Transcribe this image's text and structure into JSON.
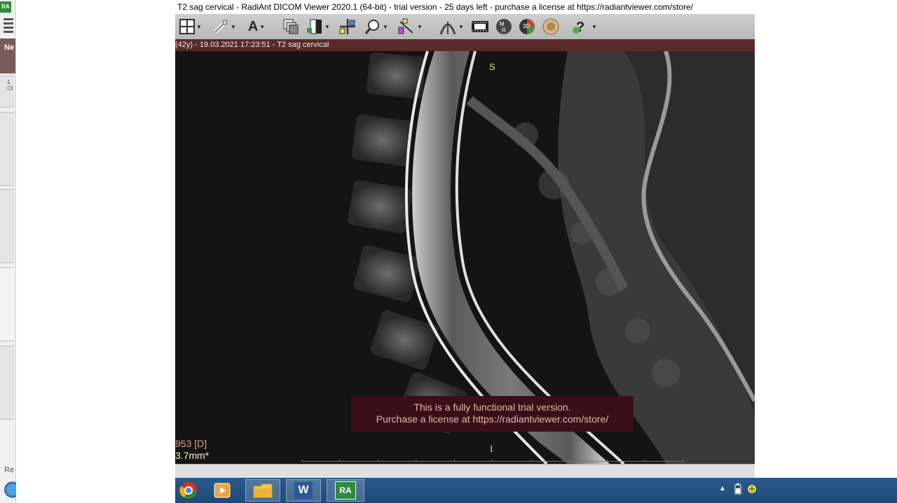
{
  "background_app": {
    "badge": "RA",
    "panel_label": "Ne",
    "thumb1_line1": "1",
    "thumb1_line2": "OI",
    "bottom_label": "Re"
  },
  "window": {
    "title": "T2 sag cervical - RadiAnt DICOM Viewer 2020.1 (64-bit) - trial version - 25 days left - purchase a license at https://radiantviewer.com/store/"
  },
  "toolbar": {
    "icons": [
      "layout-grid-icon",
      "adjust-wl-icon",
      "annotation-text-icon",
      "series-stack-icon",
      "invert-icon",
      "pan-icon",
      "zoom-icon",
      "measure-icon",
      "angle-icon",
      "reslice-icon",
      "film-icon",
      "mpr-icon",
      "volume-3d-icon",
      "fusion-icon",
      "help-icon"
    ]
  },
  "series_info": "(42y) - 19.03.2021 17:23:51 - T2 sag cervical",
  "viewer": {
    "orient_top": "S",
    "orient_bottom": "I",
    "wl_value": "953 [D]",
    "thickness": "3.7mm*",
    "trial_line1": "This is a fully functional trial version.",
    "trial_line2": "Purchase a license at https://radiantviewer.com/store/"
  },
  "taskbar": {
    "apps": [
      "chrome-icon",
      "media-player-icon",
      "file-explorer-icon",
      "word-icon",
      "radiant-icon"
    ],
    "word_label": "W",
    "radiant_label": "RA"
  },
  "colors": {
    "series_bar": "#5a2a2a",
    "trial_box": "#3a0f1a",
    "orientation": "#e6e07a",
    "overlay_text": "#e8a27a",
    "taskbar": "#1f4a78"
  }
}
